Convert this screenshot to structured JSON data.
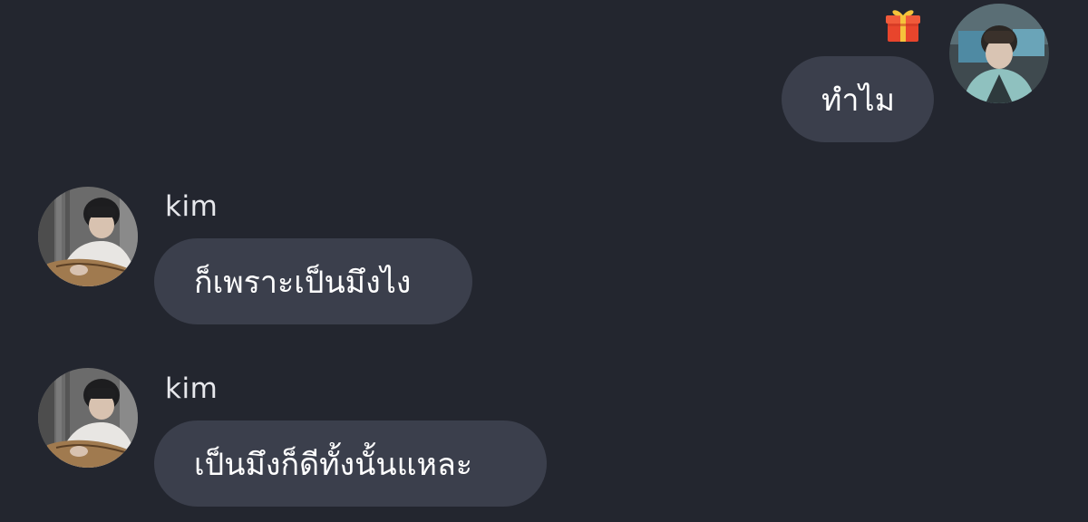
{
  "messages": [
    {
      "direction": "outgoing",
      "text": "ทำไม",
      "reaction_icon": "gift-icon"
    },
    {
      "direction": "incoming",
      "sender": "kim",
      "text": "ก็เพราะเป็นมึงไง"
    },
    {
      "direction": "incoming",
      "sender": "kim",
      "text": "เป็นมึงก็ดีทั้งนั้นแหละ"
    }
  ],
  "colors": {
    "background": "#23262f",
    "bubble": "#3b3f4c",
    "text": "#ffffff",
    "gift_box": "#e8452c",
    "gift_ribbon": "#f5c33b"
  }
}
